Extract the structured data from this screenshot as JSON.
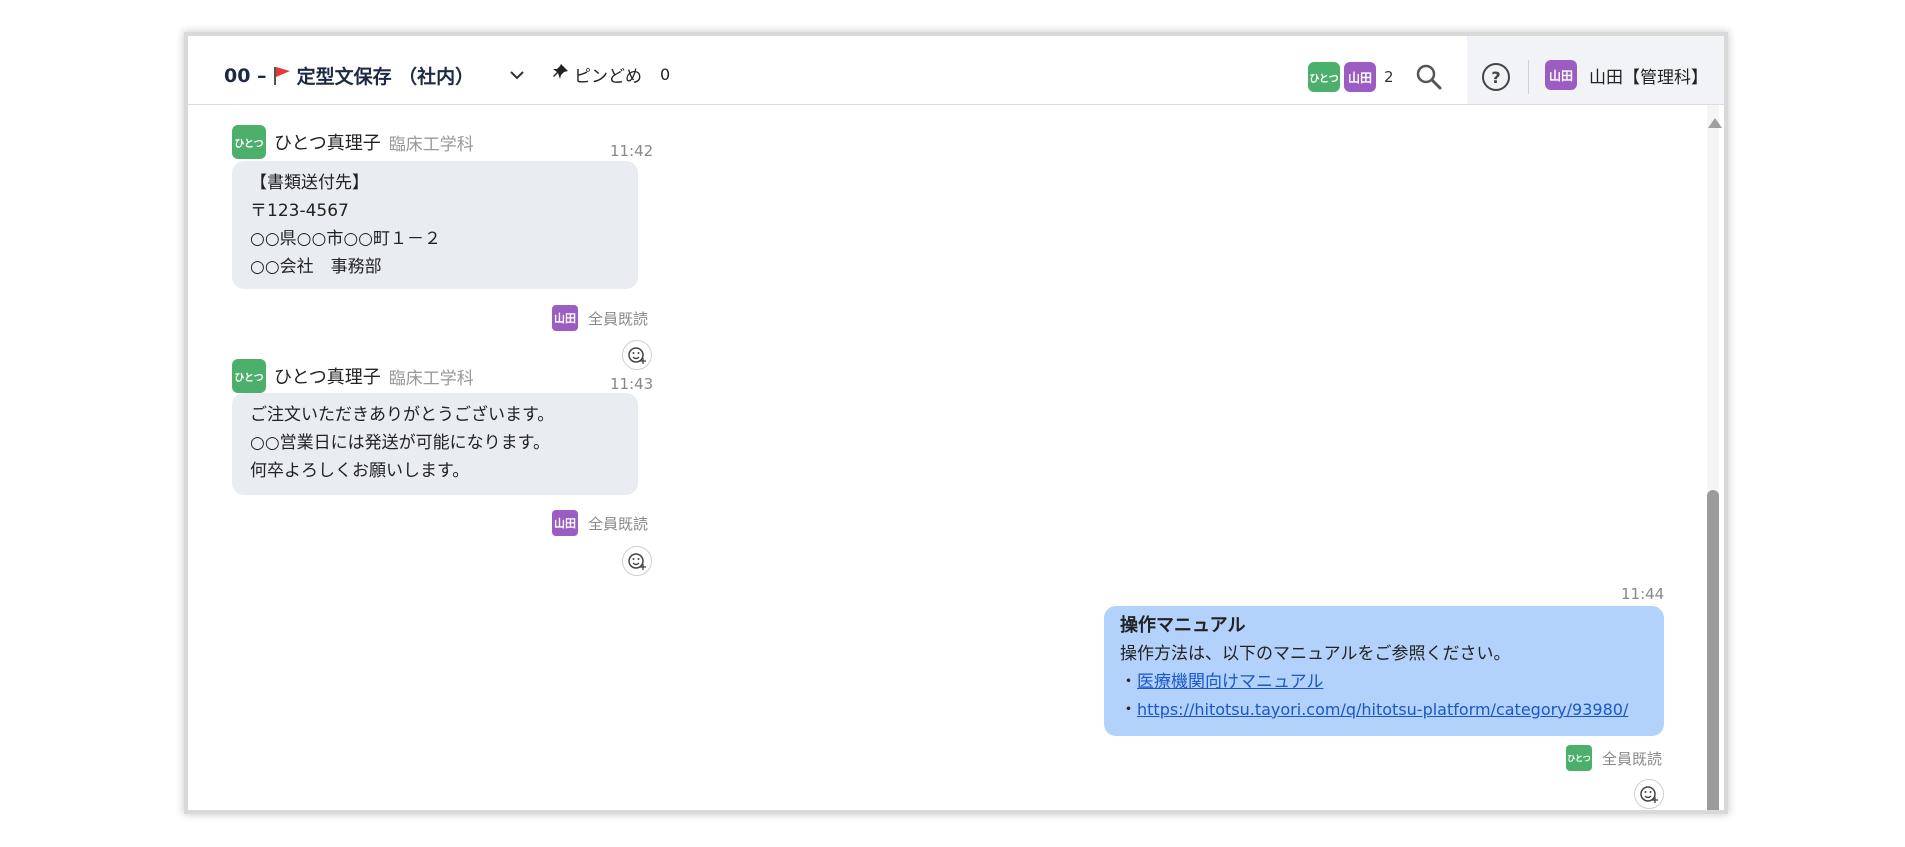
{
  "header": {
    "title_prefix": "00 –",
    "title": "定型文保存 （社内）",
    "pin_label": "ピンどめ",
    "pin_count": "0",
    "member_avatars": [
      "ひとつ",
      "山田"
    ],
    "member_count": "2",
    "user_avatar": "山田",
    "user_name": "山田【管理科】",
    "colors": {
      "flag": "#e53935",
      "green_avatar": "#4caf6c",
      "purple_avatar": "#9c5dc3"
    }
  },
  "messages": [
    {
      "avatar": "ひとつ",
      "sender": "ひとつ真理子",
      "dept": "臨床工学科",
      "time": "11:42",
      "lines": [
        "【書類送付先】",
        "〒123-4567",
        "○○県○○市○○町１－２",
        "○○会社　事務部"
      ],
      "read_avatar": "山田",
      "read_label": "全員既読"
    },
    {
      "avatar": "ひとつ",
      "sender": "ひとつ真理子",
      "dept": "臨床工学科",
      "time": "11:43",
      "lines": [
        "ご注文いただきありがとうございます。",
        "○○営業日には発送が可能になります。",
        "何卒よろしくお願いします。"
      ],
      "read_avatar": "山田",
      "read_label": "全員既読"
    },
    {
      "time": "11:44",
      "title": "操作マニュアル",
      "line1": "操作方法は、以下のマニュアルをご参照ください。",
      "bullet": "・",
      "link1": "医療機関向けマニュアル",
      "link2": "https://hitotsu.tayori.com/q/hitotsu-platform/category/93980/",
      "read_avatar": "ひとつ",
      "read_label": "全員既読",
      "bubble_color": "#b3d2fb"
    }
  ]
}
